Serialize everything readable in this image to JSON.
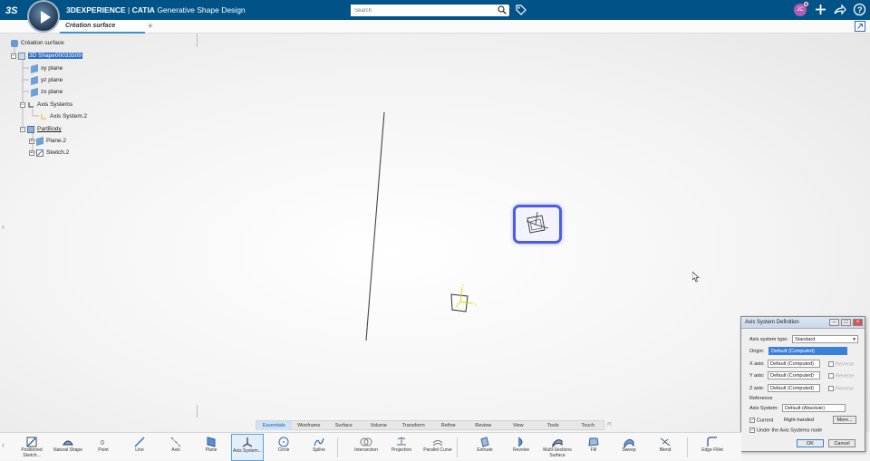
{
  "header": {
    "brand": "3DEXPERIENCE",
    "separator": " | ",
    "product": "CATIA",
    "app_name": " Generative Shape Design",
    "search_placeholder": "Search",
    "user_initials": "JC"
  },
  "tabs": [
    {
      "label": "Création surface"
    }
  ],
  "tree": {
    "root": "Création surface",
    "shape": "3D Shape00033509",
    "planes": [
      "xy plane",
      "yz plane",
      "zx plane"
    ],
    "axis_systems": "Axis Systems",
    "axis_system_item": "Axis System.2",
    "partbody": "PartBody",
    "plane_item": "Plane.2",
    "sketch_item": "Sketch.2"
  },
  "dialog": {
    "title": "Axis System Definition",
    "type_label": "Axis system type:",
    "type_value": "Standard",
    "origin_label": "Origin:",
    "origin_value": "Default (Computed)",
    "x_label": "X axis:",
    "y_label": "Y axis:",
    "z_label": "Z axis:",
    "axis_value": "Default (Computed)",
    "reverse_label": "Reverse",
    "reference_label": "Reference",
    "axis_systems_label": "Axis System:",
    "axis_systems_value": "Default (Absolute)",
    "current_label": "Current",
    "right_handed": "Right-handed",
    "more_label": "More...",
    "under_node_label": "Under the Axis Systems node",
    "ok_label": "OK",
    "cancel_label": "Cancel"
  },
  "workbench_tabs": [
    "Essentials",
    "Wireframe",
    "Surface",
    "Volume",
    "Transform",
    "Refine",
    "Review",
    "View",
    "Tools",
    "Touch"
  ],
  "active_workbench_tab": "Essentials",
  "tools": [
    {
      "label": "Positioned Sketch...",
      "icon": "positioned-sketch-icon"
    },
    {
      "label": "Natural Shape",
      "icon": "natural-shape-icon"
    },
    {
      "label": "Point",
      "icon": "point-icon"
    },
    {
      "label": "Line",
      "icon": "line-icon"
    },
    {
      "label": "Axis",
      "icon": "axis-icon"
    },
    {
      "label": "Plane",
      "icon": "plane-icon"
    },
    {
      "label": "Axis System...",
      "icon": "axis-system-icon"
    },
    {
      "label": "Circle",
      "icon": "circle-icon"
    },
    {
      "label": "Spline",
      "icon": "spline-icon"
    },
    {
      "label": "Intersection",
      "icon": "intersection-icon"
    },
    {
      "label": "Projection",
      "icon": "projection-icon"
    },
    {
      "label": "Parallel Curve",
      "icon": "parallel-curve-icon"
    },
    {
      "label": "Extrude",
      "icon": "extrude-icon"
    },
    {
      "label": "Revolve",
      "icon": "revolve-icon"
    },
    {
      "label": "Multi-Sections Surface",
      "icon": "multi-sections-surface-icon"
    },
    {
      "label": "Fill",
      "icon": "fill-icon"
    },
    {
      "label": "Sweep",
      "icon": "sweep-icon"
    },
    {
      "label": "Blend",
      "icon": "blend-icon"
    },
    {
      "label": "Edge Fillet",
      "icon": "edge-fillet-icon"
    }
  ],
  "colors": {
    "header": "#005386",
    "accent": "#2f6fc7",
    "highlight": "#4a5ce8"
  }
}
